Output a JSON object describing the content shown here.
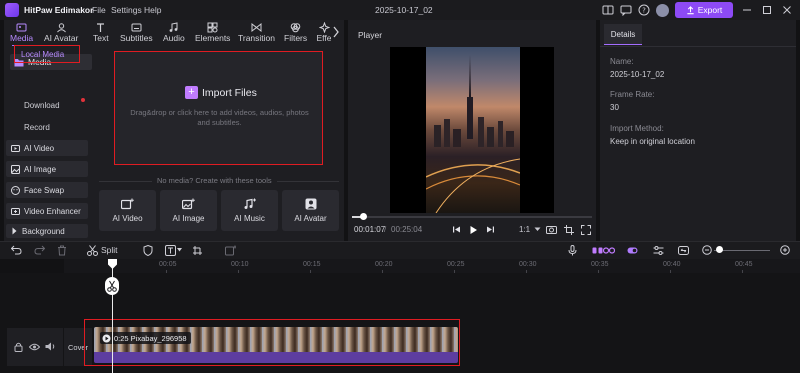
{
  "app": {
    "title": "HitPaw Edimakor",
    "menus": [
      "File",
      "Settings",
      "Help"
    ],
    "project_name": "2025-10-17_02",
    "export_label": "Export",
    "accent": "#8d4af5"
  },
  "toolbar": {
    "tools": [
      {
        "label": "Media",
        "icon": "media-icon",
        "active": true
      },
      {
        "label": "AI Avatar",
        "icon": "ai-avatar-icon"
      },
      {
        "label": "Text",
        "icon": "text-icon"
      },
      {
        "label": "Subtitles",
        "icon": "subtitles-icon"
      },
      {
        "label": "Audio",
        "icon": "audio-icon"
      },
      {
        "label": "Elements",
        "icon": "elements-icon"
      },
      {
        "label": "Transition",
        "icon": "transition-icon"
      },
      {
        "label": "Filters",
        "icon": "filters-icon"
      },
      {
        "label": "Effe",
        "icon": "effects-icon"
      }
    ]
  },
  "sidebar": {
    "media_label": "Media",
    "local_media": "Local Media",
    "download": "Download",
    "record": "Record",
    "items": [
      {
        "label": "AI Video",
        "icon": "ai-video-icon"
      },
      {
        "label": "AI Image",
        "icon": "ai-image-icon"
      },
      {
        "label": "Face Swap",
        "icon": "face-swap-icon"
      },
      {
        "label": "Video Enhancer",
        "icon": "video-enhancer-icon"
      },
      {
        "label": "Background",
        "icon": "chevron-right-icon"
      }
    ]
  },
  "import": {
    "button_label": "Import Files",
    "hint": "Drag&drop or click here to add videos, audios, photos and subtitles."
  },
  "ai_tools": {
    "heading": "No media? Create with these tools",
    "cards": [
      {
        "label": "AI Video",
        "icon": "ai-video-add-icon"
      },
      {
        "label": "AI Image",
        "icon": "ai-image-add-icon"
      },
      {
        "label": "AI Music",
        "icon": "ai-music-icon"
      },
      {
        "label": "AI Avatar",
        "icon": "ai-avatar-card-icon"
      }
    ]
  },
  "player": {
    "title": "Player",
    "current_time": "00:01:07",
    "separator": "/",
    "total_time": "00:25:04",
    "speed": "1:1",
    "progress": 0.045
  },
  "details": {
    "tab": "Details",
    "fields": [
      {
        "label": "Name:",
        "value": "2025-10-17_02"
      },
      {
        "label": "Frame Rate:",
        "value": "30"
      },
      {
        "label": "Import Method:",
        "value": "Keep in original location"
      }
    ]
  },
  "timeline": {
    "split_label": "Split",
    "ruler_ticks": [
      "00:05",
      "00:10",
      "00:15",
      "00:20",
      "00:25",
      "00:30",
      "00:35",
      "00:40",
      "00:45"
    ],
    "cover_label": "Cover",
    "clip_label": "0:25 Pixabay_296958"
  }
}
